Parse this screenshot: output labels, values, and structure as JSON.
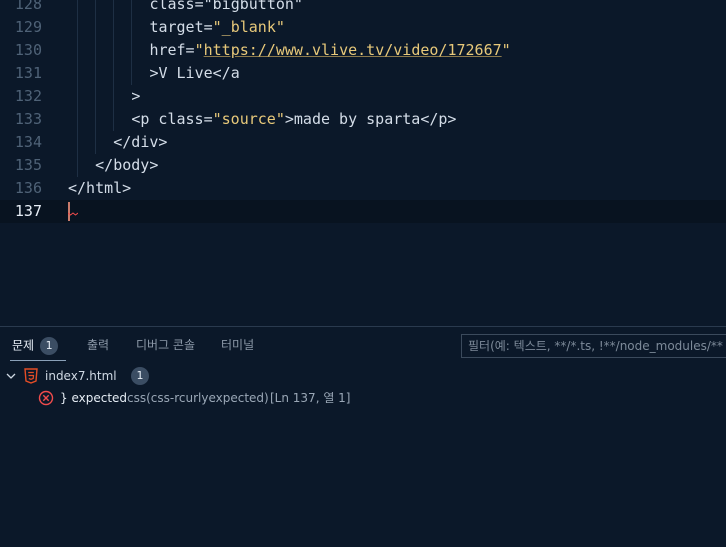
{
  "editor": {
    "lines": [
      {
        "num": "128",
        "indent": 9,
        "parts": [
          {
            "t": "class=\"bigbutton\"",
            "c": "tok-attr"
          }
        ]
      },
      {
        "num": "129",
        "indent": 9,
        "parts": [
          {
            "t": "target=",
            "c": "tok-attr"
          },
          {
            "t": "\"_blank\"",
            "c": "tok-str"
          }
        ]
      },
      {
        "num": "130",
        "indent": 9,
        "parts": [
          {
            "t": "href=",
            "c": "tok-attr"
          },
          {
            "t": "\"",
            "c": "tok-str"
          },
          {
            "t": "https://www.vlive.tv/video/172667",
            "c": "tok-url"
          },
          {
            "t": "\"",
            "c": "tok-str"
          }
        ]
      },
      {
        "num": "131",
        "indent": 9,
        "parts": [
          {
            "t": ">V Live</a",
            "c": "tok-text"
          }
        ]
      },
      {
        "num": "132",
        "indent": 7,
        "parts": [
          {
            "t": ">",
            "c": "tok-punc"
          }
        ]
      },
      {
        "num": "133",
        "indent": 7,
        "parts": [
          {
            "t": "<p class=",
            "c": "tok-tag"
          },
          {
            "t": "\"source\"",
            "c": "tok-str"
          },
          {
            "t": ">made by sparta</p>",
            "c": "tok-text"
          }
        ]
      },
      {
        "num": "134",
        "indent": 5,
        "parts": [
          {
            "t": "</div>",
            "c": "tok-tag"
          }
        ]
      },
      {
        "num": "135",
        "indent": 3,
        "parts": [
          {
            "t": "</body>",
            "c": "tok-tag"
          }
        ]
      },
      {
        "num": "136",
        "indent": 0,
        "parts": [
          {
            "t": "</html>",
            "c": "tok-tag"
          }
        ]
      },
      {
        "num": "137",
        "indent": 0,
        "parts": [],
        "current": true
      }
    ]
  },
  "panel": {
    "tabs": [
      {
        "label": "문제",
        "badge": "1",
        "active": true
      },
      {
        "label": "출력"
      },
      {
        "label": "디버그 콘솔"
      },
      {
        "label": "터미널"
      }
    ],
    "filter_placeholder": "필터(예: 텍스트, **/*.ts, !**/node_modules/**)",
    "file": {
      "name": "index7.html",
      "count": "1",
      "icon": "html5-icon",
      "expand_icon": "chevron-down-icon"
    },
    "problem": {
      "icon": "error-circle-icon",
      "message": "} expected",
      "source": "css(css-rcurlyexpected)",
      "location": "[Ln 137, 열 1]"
    }
  },
  "colors": {
    "background": "#0b1829",
    "string": "#e8c97a",
    "error": "#f14c4c"
  }
}
